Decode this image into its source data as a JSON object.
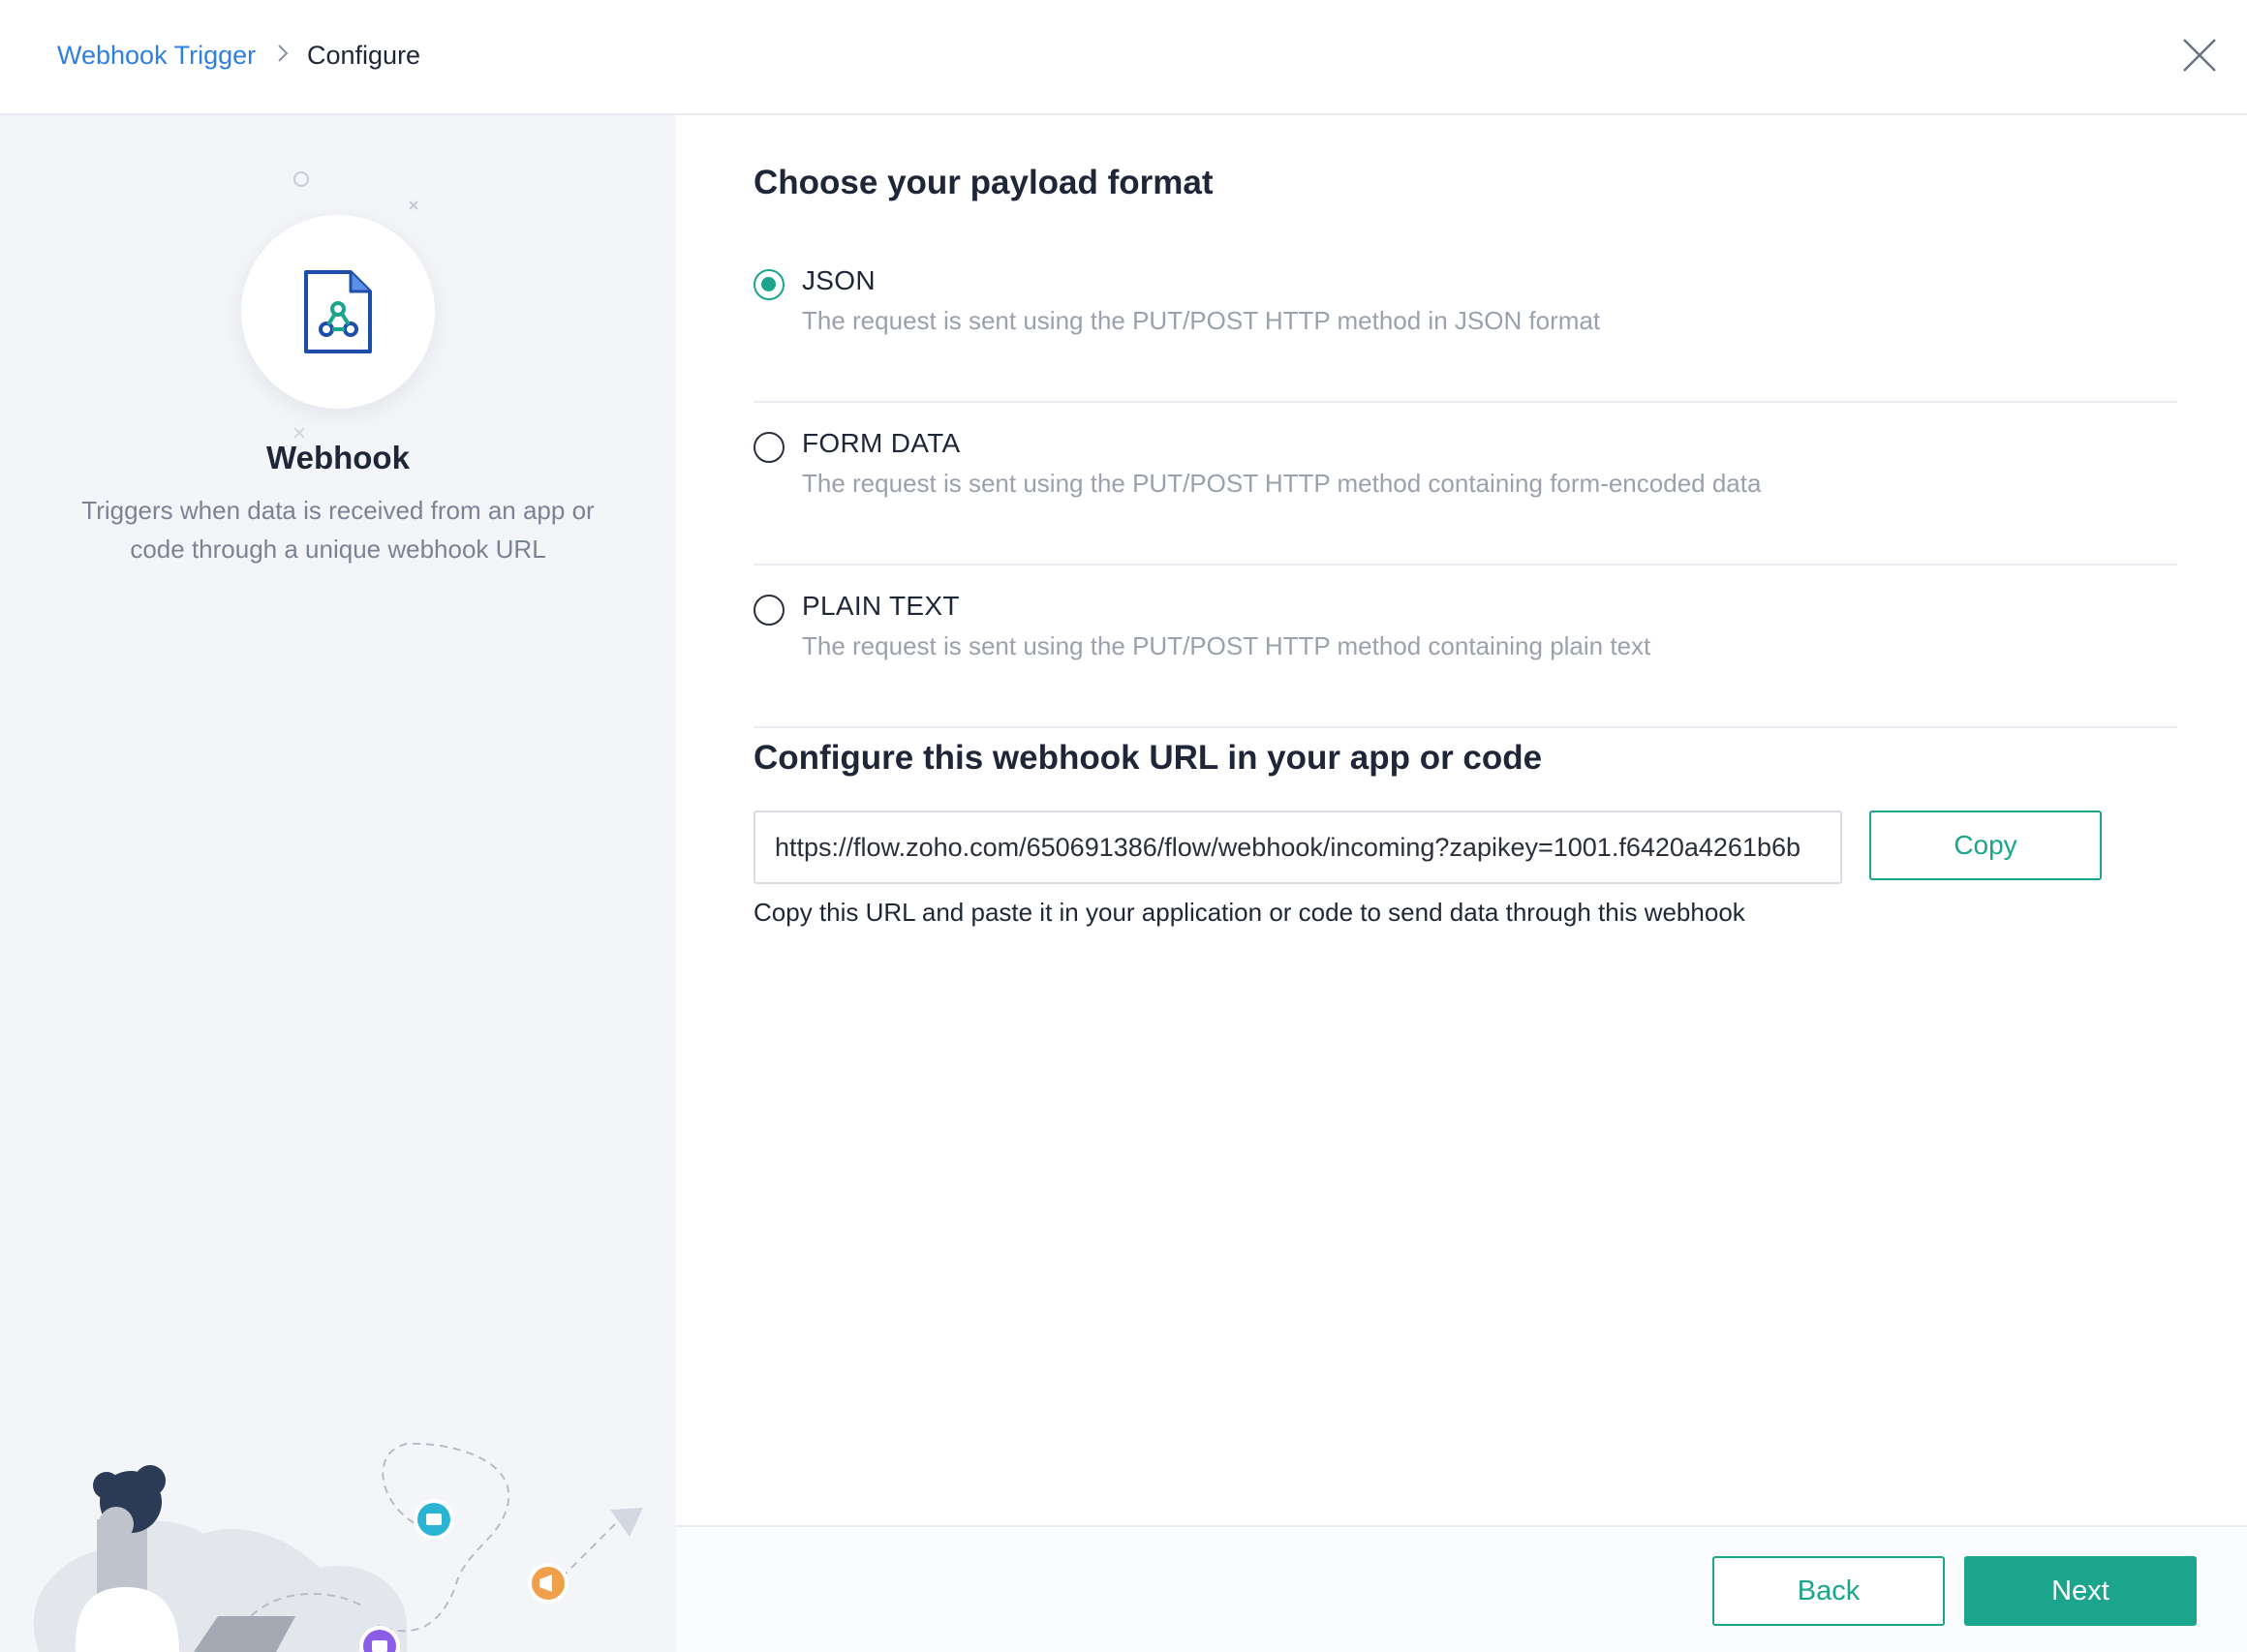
{
  "breadcrumb": {
    "parent": "Webhook Trigger",
    "current": "Configure"
  },
  "icons": {
    "chevron": "chevron-right-icon",
    "close": "close-icon",
    "app": "webhook-document-icon"
  },
  "app": {
    "name": "Webhook",
    "description": "Triggers when data is received from an app or code through a unique webhook URL"
  },
  "payload": {
    "title": "Choose your payload format",
    "selected": "JSON",
    "options": [
      {
        "label": "JSON",
        "description": "The request is sent using the PUT/POST HTTP method in JSON format"
      },
      {
        "label": "FORM DATA",
        "description": "The request is sent using the PUT/POST HTTP method containing form-encoded data"
      },
      {
        "label": "PLAIN TEXT",
        "description": "The request is sent using the PUT/POST HTTP method containing plain text"
      }
    ]
  },
  "webhook": {
    "title": "Configure this webhook URL in your app or code",
    "url": "https://flow.zoho.com/650691386/flow/webhook/incoming?zapikey=1001.f6420a4261b6b",
    "copy_label": "Copy",
    "hint": "Copy this URL and paste it in your application or code to send data through this webhook"
  },
  "footer": {
    "back_label": "Back",
    "next_label": "Next"
  },
  "colors": {
    "accent": "#1aa58c",
    "link": "#2f7fe0",
    "text": "#1f2637",
    "muted": "#9aa1ad"
  }
}
